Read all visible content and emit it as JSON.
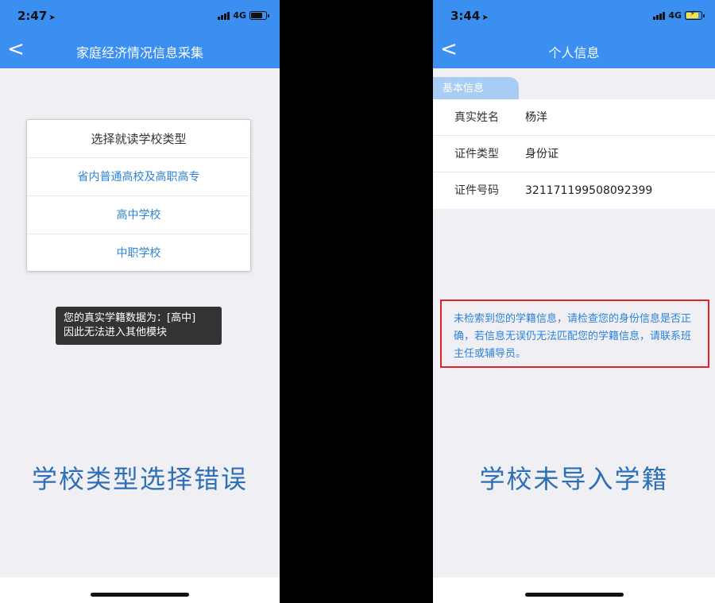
{
  "left": {
    "status": {
      "time": "2:47",
      "network": "4G"
    },
    "nav": {
      "back": "<",
      "title": "家庭经济情况信息采集"
    },
    "dialog": {
      "title": "选择就读学校类型",
      "options": [
        "省内普通高校及高职高专",
        "高中学校",
        "中职学校"
      ]
    },
    "toast": {
      "line1": "您的真实学籍数据为：[高中]",
      "line2": "因此无法进入其他模块"
    },
    "caption": "学校类型选择错误"
  },
  "right": {
    "status": {
      "time": "3:44",
      "network": "4G"
    },
    "nav": {
      "back": "<",
      "title": "个人信息"
    },
    "section": "基本信息",
    "rows": [
      {
        "label": "真实姓名",
        "value": "杨洋"
      },
      {
        "label": "证件类型",
        "value": "身份证"
      },
      {
        "label": "证件号码",
        "value": "321171199508092399"
      }
    ],
    "notice": "未检索到您的学籍信息，请检查您的身份信息是否正确，若信息无误仍无法匹配您的学籍信息，请联系班主任或辅导员。",
    "caption": "学校未导入学籍"
  },
  "colors": {
    "accent": "#3a8ff0",
    "link": "#2c83d9",
    "alert_border": "#e0222b",
    "caption": "#2e6fb5"
  }
}
